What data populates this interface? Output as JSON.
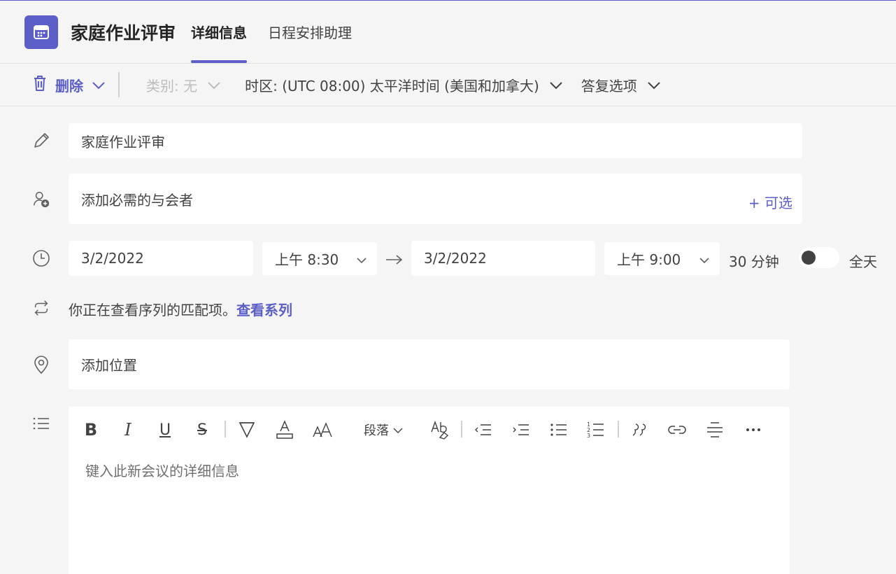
{
  "header": {
    "title": "家庭作业评审",
    "tabs": [
      {
        "label": "详细信息",
        "active": true
      },
      {
        "label": "日程安排助理",
        "active": false
      }
    ]
  },
  "toolbar": {
    "delete_label": "删除",
    "category_label": "类别: 无",
    "timezone_label": "时区: (UTC 08:00) 太平洋时间 (美国和加拿大)",
    "response_label": "答复选项"
  },
  "form": {
    "title_value": "家庭作业评审",
    "attendees_placeholder": "添加必需的与会者",
    "optional_label": "+ 可选",
    "start_date": "3/2/2022",
    "start_time": "上午 8:30",
    "end_date": "3/2/2022",
    "end_time": "上午 9:00",
    "duration": "30 分钟",
    "all_day_label": "全天",
    "all_day_on": false,
    "series_text": "你正在查看序列的匹配项。",
    "series_link": "查看系列",
    "location_placeholder": "添加位置",
    "details_placeholder": "键入此新会议的详细信息"
  },
  "editor_toolbar": {
    "paragraph_label": "段落"
  },
  "colors": {
    "accent": "#5b5fc7",
    "background": "#f5f5f5"
  },
  "icons": [
    "calendar-icon",
    "trash-icon",
    "chevron-down-icon",
    "pencil-icon",
    "add-person-icon",
    "clock-icon",
    "repeat-icon",
    "location-icon",
    "list-icon",
    "arrow-right-icon"
  ]
}
